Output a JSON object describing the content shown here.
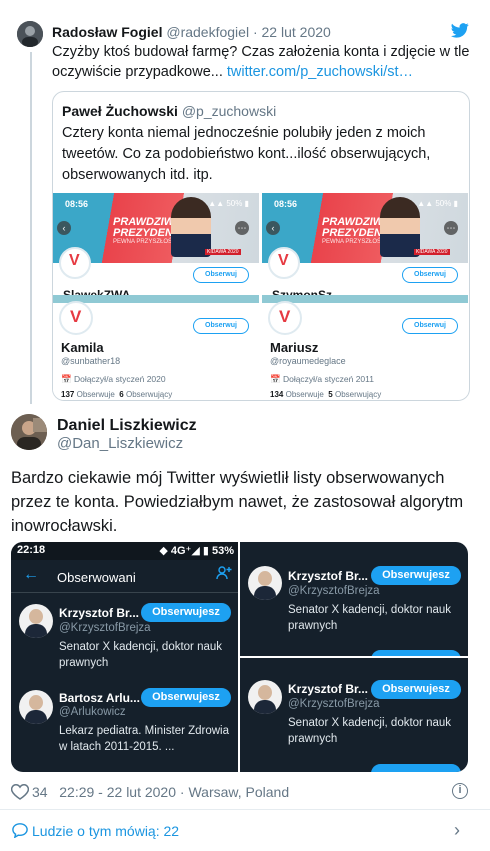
{
  "parent_tweet": {
    "name": "Radosław Fogiel",
    "handle": "@radekfogiel",
    "dot": "·",
    "date": "22 lut 2020",
    "text": "Czyżby ktoś budował farmę? Czas założenia konta i zdjęcie w tle oczywiście przypadkowe...",
    "link": "twitter.com/p_zuchowski/st…"
  },
  "quoted_tweet": {
    "name": "Paweł Żuchowski",
    "handle": "@p_zuchowski",
    "text": "Cztery konta niemal jednocześnie polubiły jeden z moich tweetów. Co za podobieństwo kont...ilość obserwujących, obserwowanych itd. itp.",
    "images": [
      {
        "time": "08:56",
        "signal": "▲▲ 50% ▮",
        "banner_line1": "PRAWDZIWA",
        "banner_line2": "PREZYDENT",
        "banner_sub": "PEWNA PRZYSZŁOŚĆ",
        "candidate": "KIDAWA 2020",
        "follow_label": "Obserwuj",
        "cut_name": "SlawekZWA",
        "name": "Kamila",
        "handle": "@sunbather18",
        "joined": "Dołączył/a styczeń 2020",
        "following_count": "137",
        "following_label": "Obserwuje",
        "followers_count": "6",
        "followers_label": "Obserwujący"
      },
      {
        "time": "08:56",
        "signal": "▲▲ 50% ▮",
        "banner_line1": "PRAWDZIWA",
        "banner_line2": "PREZYDENT",
        "banner_sub": "PEWNA PRZYSZŁOŚĆ",
        "candidate": "KIDAWA 2020",
        "follow_label": "Obserwuj",
        "cut_name": "SzymonSz",
        "name": "Mariusz",
        "handle": "@royaumedeglace",
        "joined": "Dołączył/a styczeń 2011",
        "following_count": "134",
        "following_label": "Obserwuje",
        "followers_count": "5",
        "followers_label": "Obserwujący"
      }
    ]
  },
  "main_tweet": {
    "name": "Daniel Liszkiewicz",
    "handle": "@Dan_Liszkiewicz",
    "text": "Bardzo ciekawie mój Twitter wyświetlił listy obserwowanych przez te konta. Powiedziałbym nawet, że zastosował algorytm inowrocławski."
  },
  "screenshots": {
    "left": {
      "time": "22:18",
      "status_right": "◆ 4G⁺◢ ▮ 53%",
      "title": "Obserwowani",
      "rows": [
        {
          "name": "Krzysztof Br...",
          "handle": "@KrzysztofBrejza",
          "bio": "Senator X kadencji, doktor nauk prawnych",
          "button": "Obserwujesz"
        },
        {
          "name": "Bartosz Arlu...",
          "handle": "@Arlukowicz",
          "bio": "Lekarz pediatra. Minister Zdrowia w latach 2011-2015. ...",
          "button": "Obserwujesz"
        }
      ]
    },
    "right_top": {
      "name": "Krzysztof Br...",
      "handle": "@KrzysztofBrejza",
      "bio": "Senator X kadencji, doktor nauk prawnych",
      "button": "Obserwujesz"
    },
    "right_bottom": {
      "name": "Krzysztof Br...",
      "handle": "@KrzysztofBrejza",
      "bio": "Senator X kadencji, doktor nauk prawnych",
      "button": "Obserwujesz"
    }
  },
  "footer": {
    "likes": "34",
    "timestamp": "22:29 - 22 lut 2020",
    "dot": "·",
    "location": "Warsaw, Poland",
    "people_talking": "Ludzie o tym mówią: 22"
  },
  "colors": {
    "link": "#1b95e0",
    "twitter_blue": "#1da1f2",
    "dark_bg": "#15202b",
    "secondary": "#657786"
  }
}
